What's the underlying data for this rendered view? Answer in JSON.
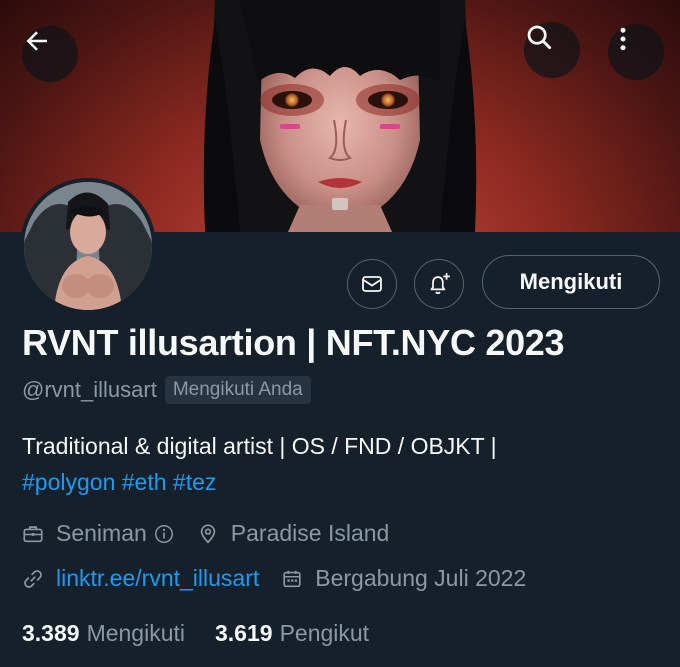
{
  "profile": {
    "display_name": "RVNT illusartion | NFT.NYC 2023",
    "handle": "@rvnt_illusart",
    "follows_you": "Mengikuti Anda",
    "bio_text": "Traditional & digital artist | OS / FND / OBJKT |",
    "hashtags": [
      "#polygon",
      "#eth",
      "#tez"
    ],
    "category": "Seniman",
    "location": "Paradise Island",
    "website": "linktr.ee/rvnt_illusart",
    "joined": "Bergabung Juli 2022"
  },
  "actions": {
    "follow_label": "Mengikuti"
  },
  "stats": {
    "following_count": "3.389",
    "following_label": "Mengikuti",
    "followers_count": "3.619",
    "followers_label": "Pengikut"
  },
  "icons": {
    "back": "arrow-left-icon",
    "search": "search-icon",
    "more": "more-vertical-icon",
    "message": "envelope-icon",
    "notify": "bell-plus-icon",
    "category": "briefcase-icon",
    "info": "info-icon",
    "location": "location-pin-icon",
    "link": "link-icon",
    "calendar": "calendar-icon"
  },
  "colors": {
    "background": "#15202b",
    "text_primary": "#f7f9f9",
    "text_secondary": "#8b98a5",
    "accent": "#1d9bf0",
    "border": "#536471"
  }
}
